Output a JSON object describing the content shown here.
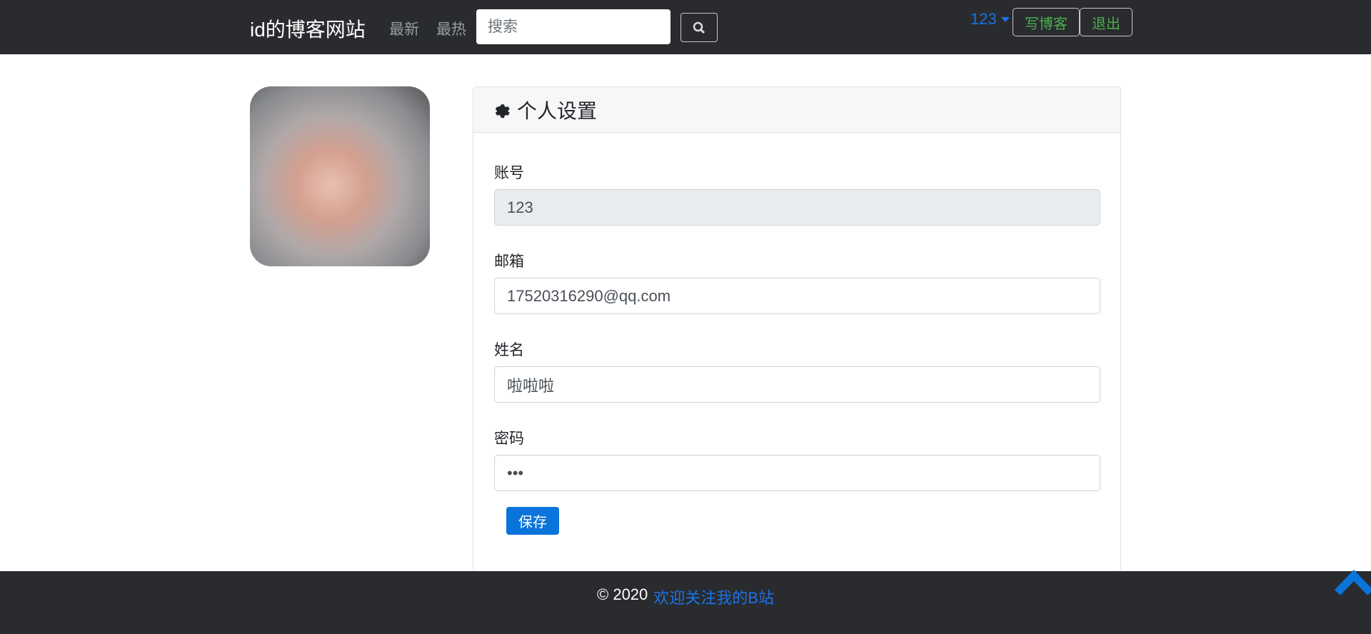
{
  "nav": {
    "brand": "id的博客网站",
    "links": [
      "最新",
      "最热"
    ],
    "search_placeholder": "搜索",
    "user": "123",
    "write_label": "写博客",
    "logout_label": "退出"
  },
  "card": {
    "title": "个人设置",
    "fields": [
      {
        "label": "账号",
        "value": "123",
        "disabled": true
      },
      {
        "label": "邮箱",
        "value": "17520316290@qq.com"
      },
      {
        "label": "姓名",
        "value": "啦啦啦"
      },
      {
        "label": "密码",
        "value": "•••"
      }
    ],
    "save_label": "保存"
  },
  "footer": {
    "copyright": "© 2020",
    "link": "欢迎关注我的B站"
  },
  "colors": {
    "navbar": "#292b2e",
    "accent": "#0a74da",
    "green": "#4caf50"
  }
}
